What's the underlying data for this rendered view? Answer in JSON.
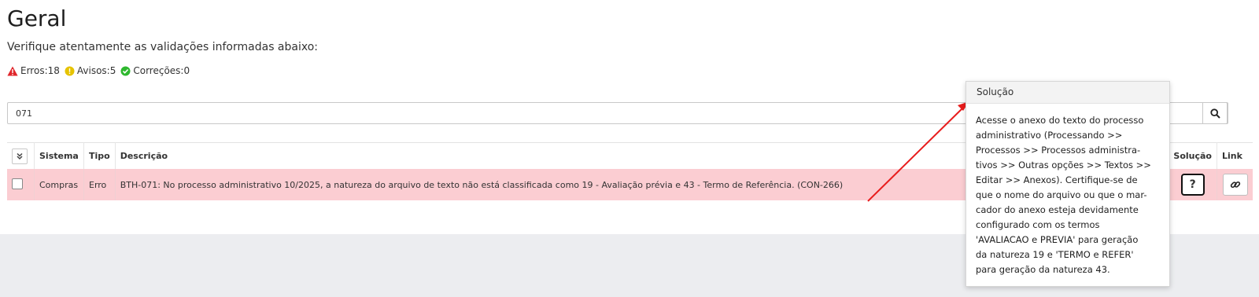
{
  "page": {
    "title": "Geral",
    "subtitle": "Verifique atentamente as validações informadas abaixo:"
  },
  "counters": {
    "errors": "Erros:18",
    "warnings": "Avisos:5",
    "corrections": "Correções:0"
  },
  "search": {
    "value": "071"
  },
  "table": {
    "headers": {
      "sistema": "Sistema",
      "tipo": "Tipo",
      "descricao": "Descrição",
      "solucao": "Solução",
      "link": "Link"
    },
    "rows": [
      {
        "sistema": "Compras",
        "tipo": "Erro",
        "descricao": "BTH-071: No processo administrativo 10/2025, a natureza do arquivo de texto não está classificada como 19 - Avaliação prévia e 43 - Termo de Referência. (CON-266)",
        "solucao_label": "?"
      }
    ]
  },
  "popover": {
    "title": "Solução",
    "body": "Acesse o anexo do texto do processo\nadministrativo (Processando >>\nProcessos >> Processos administra-\ntivos >> Outras opções >> Textos >>\nEditar >> Anexos). Certifique-se de\nque o nome do arquivo ou que o mar-\ncador do anexo esteja devidamente\nconfigurado com os termos\n'AVALIACAO e PREVIA' para geração\nda natureza 19 e 'TERMO e REFER'\npara geração da natureza 43."
  },
  "colors": {
    "error_row": "#fbcdd2",
    "error_icon": "#e0262b",
    "warning_icon": "#e6c300",
    "correction_icon": "#2eb82e",
    "annotation_arrow": "#e81c1c"
  }
}
